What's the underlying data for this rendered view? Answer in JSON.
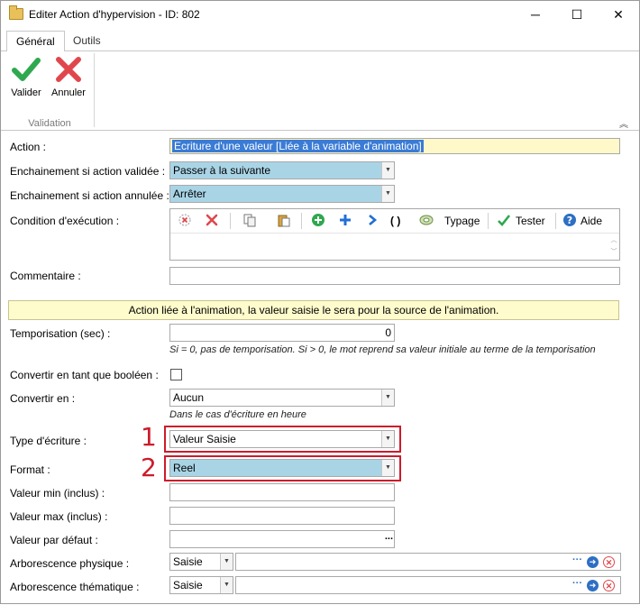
{
  "window": {
    "title": "Editer Action d'hypervision - ID: 802",
    "minimize_glyph": "─",
    "maximize_glyph": "☐",
    "close_glyph": "✕"
  },
  "ribbon": {
    "tabs": [
      {
        "label": "Général"
      },
      {
        "label": "Outils"
      }
    ],
    "buttons": {
      "validate": "Valider",
      "cancel": "Annuler"
    },
    "group_label": "Validation"
  },
  "colors": {
    "accent_green": "#2fa84f",
    "accent_red": "#e0474c",
    "highlight_blue": "#a9d4e6",
    "annotation_red": "#cc1b2b",
    "banner_yellow": "#fefbcc"
  },
  "form": {
    "action": {
      "label": "Action :",
      "value": "Ecriture d'une valeur [Liée à la variable d'animation]"
    },
    "enchainement_validee": {
      "label": "Enchainement si action validée :",
      "value": "Passer à la suivante"
    },
    "enchainement_annulee": {
      "label": "Enchainement si action annulée :",
      "value": "Arrêter"
    },
    "condition": {
      "label": "Condition d'exécution :",
      "toolbar": {
        "parens": "( )",
        "typage": "Typage",
        "tester": "Tester",
        "aide": "Aide"
      }
    },
    "commentaire": {
      "label": "Commentaire :",
      "value": ""
    },
    "banner": "Action liée à l'animation, la valeur saisie le sera pour la source de l'animation.",
    "temporisation": {
      "label": "Temporisation (sec) :",
      "value": "0",
      "hint": "Si = 0, pas de temporisation. Si > 0, le mot reprend sa valeur initiale au terme de la temporisation"
    },
    "convertir_booleen": {
      "label": "Convertir en tant que booléen :",
      "checked": false
    },
    "convertir_en": {
      "label": "Convertir en :",
      "value": "Aucun",
      "hint": "Dans le cas d'écriture en heure"
    },
    "type_ecriture": {
      "label": "Type d'écriture :",
      "value": "Valeur Saisie",
      "annotation": "1"
    },
    "format": {
      "label": "Format :",
      "value": "Reel",
      "annotation": "2"
    },
    "valeur_min": {
      "label": "Valeur min (inclus) :",
      "value": ""
    },
    "valeur_max": {
      "label": "Valeur max (inclus) :",
      "value": ""
    },
    "valeur_defaut": {
      "label": "Valeur par défaut :",
      "value": "",
      "button": "..."
    },
    "arbo_physique": {
      "label": "Arborescence physique :",
      "mode": "Saisie",
      "value": "",
      "ellipsis": "···"
    },
    "arbo_thematique": {
      "label": "Arborescence thématique :",
      "mode": "Saisie",
      "value": "",
      "ellipsis": "···"
    }
  }
}
